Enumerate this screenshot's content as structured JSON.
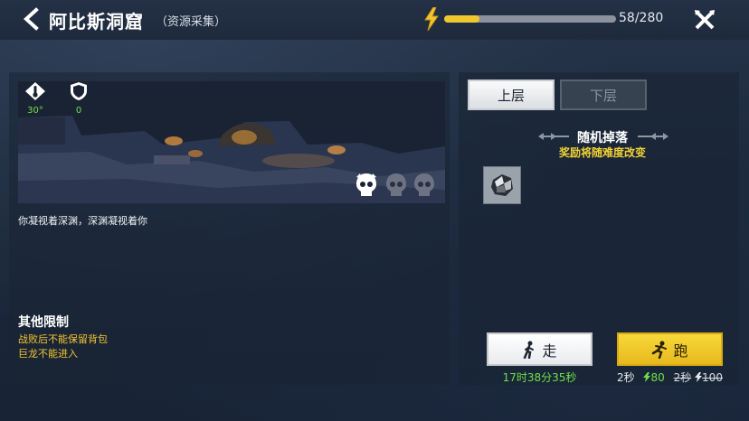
{
  "header": {
    "title": "阿比斯洞窟",
    "subtitle": "（资源采集）",
    "energy": {
      "current": 58,
      "max": 280,
      "text": "58/280",
      "fill_fraction": 0.207
    }
  },
  "scene": {
    "stats": [
      {
        "icon": "thermometer-icon",
        "value": "30°"
      },
      {
        "icon": "shield-icon",
        "value": "0"
      }
    ],
    "description": "你凝视着深渊，深渊凝视着你",
    "boss_skulls": 3
  },
  "restrictions": {
    "title": "其他限制",
    "lines": [
      "战败后不能保留背包",
      "巨龙不能进入"
    ]
  },
  "tabs": [
    {
      "label": "上层",
      "active": true
    },
    {
      "label": "下层",
      "active": false
    }
  ],
  "drops": {
    "title": "随机掉落",
    "subtitle": "奖励将随难度改变",
    "items": [
      {
        "icon": "ore-icon"
      }
    ]
  },
  "actions": {
    "walk": {
      "label": "走",
      "time": "17时38分35秒"
    },
    "run": {
      "label": "跑",
      "time": "2秒",
      "cost": "80",
      "original_time": "2秒",
      "original_cost": "100"
    }
  },
  "colors": {
    "accent_yellow": "#f2c530",
    "green_text": "#6fe04a",
    "energy_fill": "#f0c72e"
  }
}
